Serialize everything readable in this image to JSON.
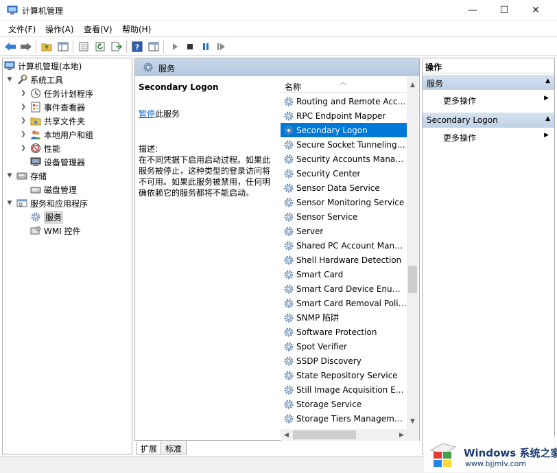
{
  "window": {
    "title": "计算机管理",
    "min_glyph": "—",
    "max_glyph": "☐",
    "close_glyph": "✕"
  },
  "menu": {
    "items": [
      "文件(F)",
      "操作(A)",
      "查看(V)",
      "帮助(H)"
    ]
  },
  "tree": {
    "root": "计算机管理(本地)",
    "system_tools": "系统工具",
    "task_scheduler": "任务计划程序",
    "event_viewer": "事件查看器",
    "shared_folders": "共享文件夹",
    "local_users": "本地用户和组",
    "performance": "性能",
    "device_manager": "设备管理器",
    "storage": "存储",
    "disk_management": "磁盘管理",
    "services_apps": "服务和应用程序",
    "services": "服务",
    "wmi": "WMI 控件"
  },
  "middle": {
    "header_title": "服务",
    "selected_service": "Secondary Logon",
    "pause_link": "暂停",
    "pause_suffix": "此服务",
    "desc_label": "描述:",
    "description": "在不同凭据下启用启动过程。如果此服务被停止，这种类型的登录访问将不可用。如果此服务被禁用，任何明确依赖它的服务都将不能启动。",
    "column_name": "名称",
    "services": [
      "Routing and Remote Access",
      "RPC Endpoint Mapper",
      "Secondary Logon",
      "Secure Socket Tunneling Protocol Service",
      "Security Accounts Manager",
      "Security Center",
      "Sensor Data Service",
      "Sensor Monitoring Service",
      "Sensor Service",
      "Server",
      "Shared PC Account Manager",
      "Shell Hardware Detection",
      "Smart Card",
      "Smart Card Device Enumeration Service",
      "Smart Card Removal Policy",
      "SNMP 陷阱",
      "Software Protection",
      "Spot Verifier",
      "SSDP Discovery",
      "State Repository Service",
      "Still Image Acquisition Events",
      "Storage Service",
      "Storage Tiers Management"
    ],
    "selected_index": 2
  },
  "tabs": {
    "extended": "扩展",
    "standard": "标准"
  },
  "actions": {
    "header": "操作",
    "group1": "服务",
    "group1_more": "更多操作",
    "group2": "Secondary Logon",
    "group2_more": "更多操作"
  },
  "watermark": {
    "brand": "Windows 系统之家",
    "url": "www.bjjmlv.com"
  },
  "colors": {
    "selection": "#0078d7",
    "header_blue": "#b4c7de",
    "link": "#0066cc"
  }
}
